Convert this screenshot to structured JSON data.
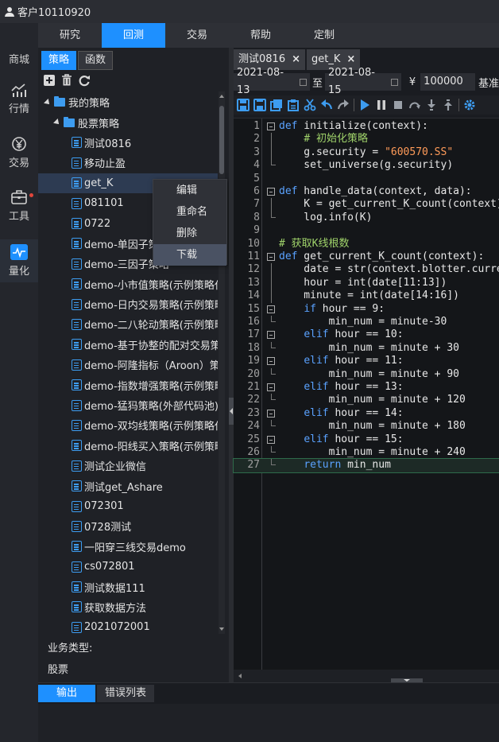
{
  "account": {
    "label": "客户10110920"
  },
  "rail": {
    "items": [
      {
        "label": "商城",
        "icon": "shop-icon"
      },
      {
        "label": "行情",
        "icon": "chart-icon"
      },
      {
        "label": "交易",
        "icon": "yen-icon"
      },
      {
        "label": "工具",
        "icon": "toolbox-icon"
      },
      {
        "label": "量化",
        "icon": "quant-icon"
      }
    ],
    "active": "量化"
  },
  "mainnav": {
    "tabs": [
      {
        "label": "研究"
      },
      {
        "label": "回测"
      },
      {
        "label": "交易"
      },
      {
        "label": "帮助"
      },
      {
        "label": "定制"
      }
    ],
    "active": "回测"
  },
  "leftpanel": {
    "subtabs": [
      {
        "label": "策略"
      },
      {
        "label": "函数"
      }
    ],
    "active_subtab": "策略",
    "root_folder": "我的策略",
    "sub_folder": "股票策略",
    "strategies": [
      "测试0816",
      "移动止盈",
      "get_K",
      "081101",
      "0722",
      "demo-单因子策略",
      "demo-三因子策略",
      "demo-小市值策略(示例策略仅",
      "demo-日内交易策略(示例策略",
      "demo-二八轮动策略(示例策略",
      "demo-基于协整的配对交易策略",
      "demo-阿隆指标（Aroon）策略",
      "demo-指数增强策略(示例策略",
      "demo-猛犸策略(外部代码池)(示",
      "demo-双均线策略(示例策略仅",
      "demo-阳线买入策略(示例策略",
      "测试企业微信",
      "测试get_Ashare",
      "072301",
      "0728测试",
      "一阳穿三线交易demo",
      "cs072801",
      "测试数据111",
      "获取数据方法",
      "2021072001"
    ],
    "selected": "get_K",
    "business_type_label": "业务类型:",
    "business_type_value": "股票"
  },
  "context_menu": {
    "items": [
      "编辑",
      "重命名",
      "删除",
      "下载"
    ],
    "highlighted": "下载"
  },
  "editor": {
    "tabs": [
      {
        "label": "测试0816",
        "close": "×"
      },
      {
        "label": "get_K",
        "close": "×"
      }
    ],
    "active_tab": "get_K",
    "start_date": "2021-08-13",
    "to_label": "至",
    "end_date": "2021-08-15",
    "currency": "¥",
    "capital": "100000",
    "benchmark_label": "基准",
    "code_lines": [
      "def initialize(context):",
      "    # 初始化策略",
      "    g.security = \"600570.SS\"",
      "    set_universe(g.security)",
      "",
      "def handle_data(context, data):",
      "    K = get_current_K_count(context)",
      "    log.info(K)",
      "",
      "# 获取K线根数",
      "def get_current_K_count(context):",
      "    date = str(context.blotter.current",
      "    hour = int(date[11:13])",
      "    minute = int(date[14:16])",
      "    if hour == 9:",
      "        min_num = minute-30",
      "    elif hour == 10:",
      "        min_num = minute + 30",
      "    elif hour == 11:",
      "        min_num = minute + 90",
      "    elif hour == 13:",
      "        min_num = minute + 120",
      "    elif hour == 14:",
      "        min_num = minute + 180",
      "    elif hour == 15:",
      "        min_num = minute + 240",
      "    return min_num"
    ],
    "current_line": 27
  },
  "output": {
    "tabs": [
      {
        "label": "输出"
      },
      {
        "label": "错误列表"
      }
    ],
    "active": "输出"
  },
  "colors": {
    "accent": "#1e90ff",
    "keyword": "#5aa2ff",
    "comment": "#9fd26a",
    "string": "#ff9b59"
  }
}
